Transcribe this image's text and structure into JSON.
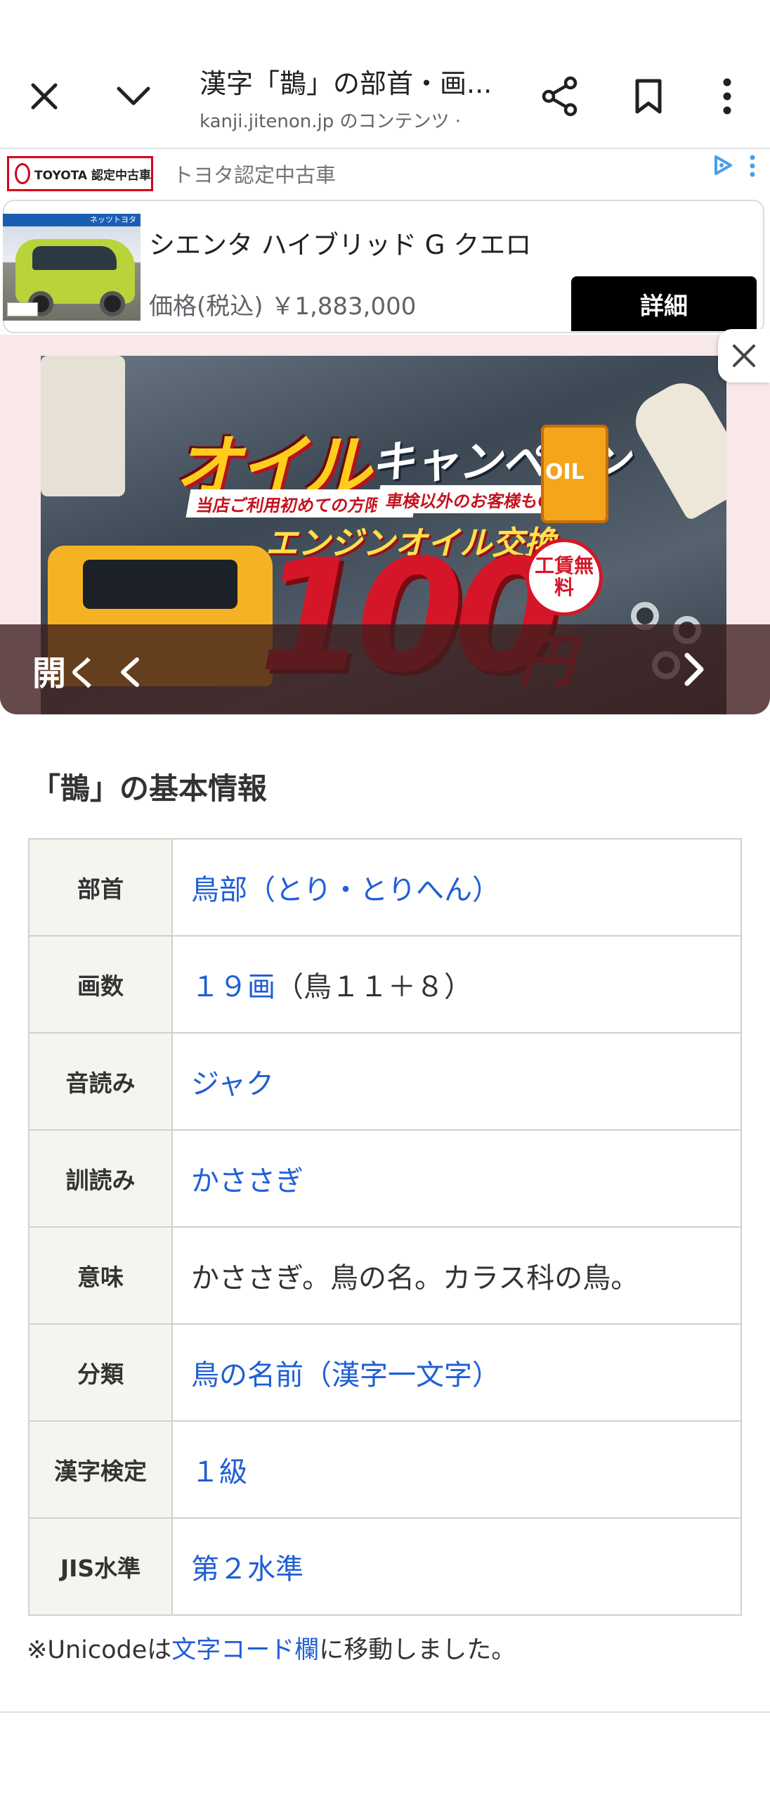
{
  "browser": {
    "title": "漢字「鵲」の部首・画...",
    "url": "kanji.jitenon.jp のコンテンツ ·"
  },
  "ad_top": {
    "brand_logo_text": "TOYOTA 認定中古車",
    "advertiser": "トヨタ認定中古車",
    "thumb_tag": "ネッツトヨタ",
    "product_name": "シエンタ ハイブリッド G クエロ",
    "price": "価格(税込) ￥1,883,000",
    "cta_label": "詳細"
  },
  "ad_banner": {
    "open_label": "開く",
    "creative": {
      "title": "オイル",
      "title2": "キャンペーン",
      "pill1": "当店ご利用初めての方限定!",
      "pill2": "車検以外のお客様もOK!",
      "subtitle": "エンジンオイル交換",
      "oil_label": "OIL",
      "price_number": "100",
      "price_unit": "円",
      "badge": "工賃無料"
    }
  },
  "section": {
    "title": "「鵲」の基本情報"
  },
  "table": {
    "rows": [
      {
        "label": "部首",
        "value": "鳥部（とり・とりへん）",
        "suffix": ""
      },
      {
        "label": "画数",
        "value": "１９画",
        "suffix": "（鳥１１＋８）"
      },
      {
        "label": "音読み",
        "value": "ジャク",
        "suffix": ""
      },
      {
        "label": "訓読み",
        "value": "かささぎ",
        "suffix": ""
      },
      {
        "label": "意味",
        "value": "かささぎ。鳥の名。カラス科の鳥。",
        "suffix": ""
      },
      {
        "label": "分類",
        "value": "鳥の名前（漢字一文字）",
        "suffix": ""
      },
      {
        "label": "漢字検定",
        "value": "１級",
        "suffix": ""
      },
      {
        "label": "JIS水準",
        "value": "第２水準",
        "suffix": ""
      }
    ]
  },
  "note": {
    "prefix": "※Unicodeは",
    "link": "文字コード欄",
    "suffix": "に移動しました。"
  },
  "icons": {
    "close": "close-icon",
    "chevron": "chevron-down-icon",
    "share": "share-icon",
    "bookmark": "bookmark-icon",
    "more": "more-vert-icon",
    "ad_close": "close-icon",
    "ad_next": "chevron-right-icon"
  },
  "colors": {
    "link": "#1f5ed6",
    "table_header_bg": "#f5f5f0",
    "ad_cta_bg": "#000000",
    "banner_bg": "#f8e8ea"
  }
}
